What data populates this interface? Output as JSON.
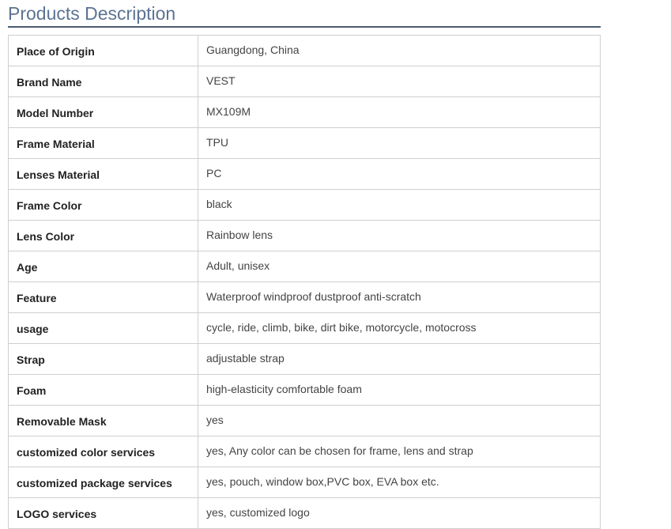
{
  "section": {
    "title": "Products Description"
  },
  "specs": [
    {
      "label": "Place of Origin",
      "value": "Guangdong, China"
    },
    {
      "label": "Brand Name",
      "value": "VEST"
    },
    {
      "label": "Model Number",
      "value": "MX109M"
    },
    {
      "label": "Frame Material",
      "value": "TPU"
    },
    {
      "label": "Lenses Material",
      "value": "PC"
    },
    {
      "label": "Frame Color",
      "value": "black"
    },
    {
      "label": "Lens Color",
      "value": "Rainbow lens"
    },
    {
      "label": "Age",
      "value": "Adult, unisex"
    },
    {
      "label": "Feature",
      "value": "Waterproof windproof dustproof anti-scratch"
    },
    {
      "label": "usage",
      "value": "cycle, ride, climb, bike, dirt bike, motorcycle, motocross"
    },
    {
      "label": "Strap",
      "value": "adjustable strap"
    },
    {
      "label": "Foam",
      "value": "high-elasticity comfortable foam"
    },
    {
      "label": "Removable Mask",
      "value": "yes"
    },
    {
      "label": "customized color services",
      "value": "yes, Any color can be chosen for frame, lens and strap"
    },
    {
      "label": "customized package services",
      "value": "yes, pouch, window box,PVC box, EVA box etc."
    },
    {
      "label": "LOGO services",
      "value": "yes, customized logo"
    }
  ],
  "colors": {
    "heading_text": "#5b7393",
    "heading_rule": "#4a5c73",
    "table_border": "#cfcfcf"
  }
}
